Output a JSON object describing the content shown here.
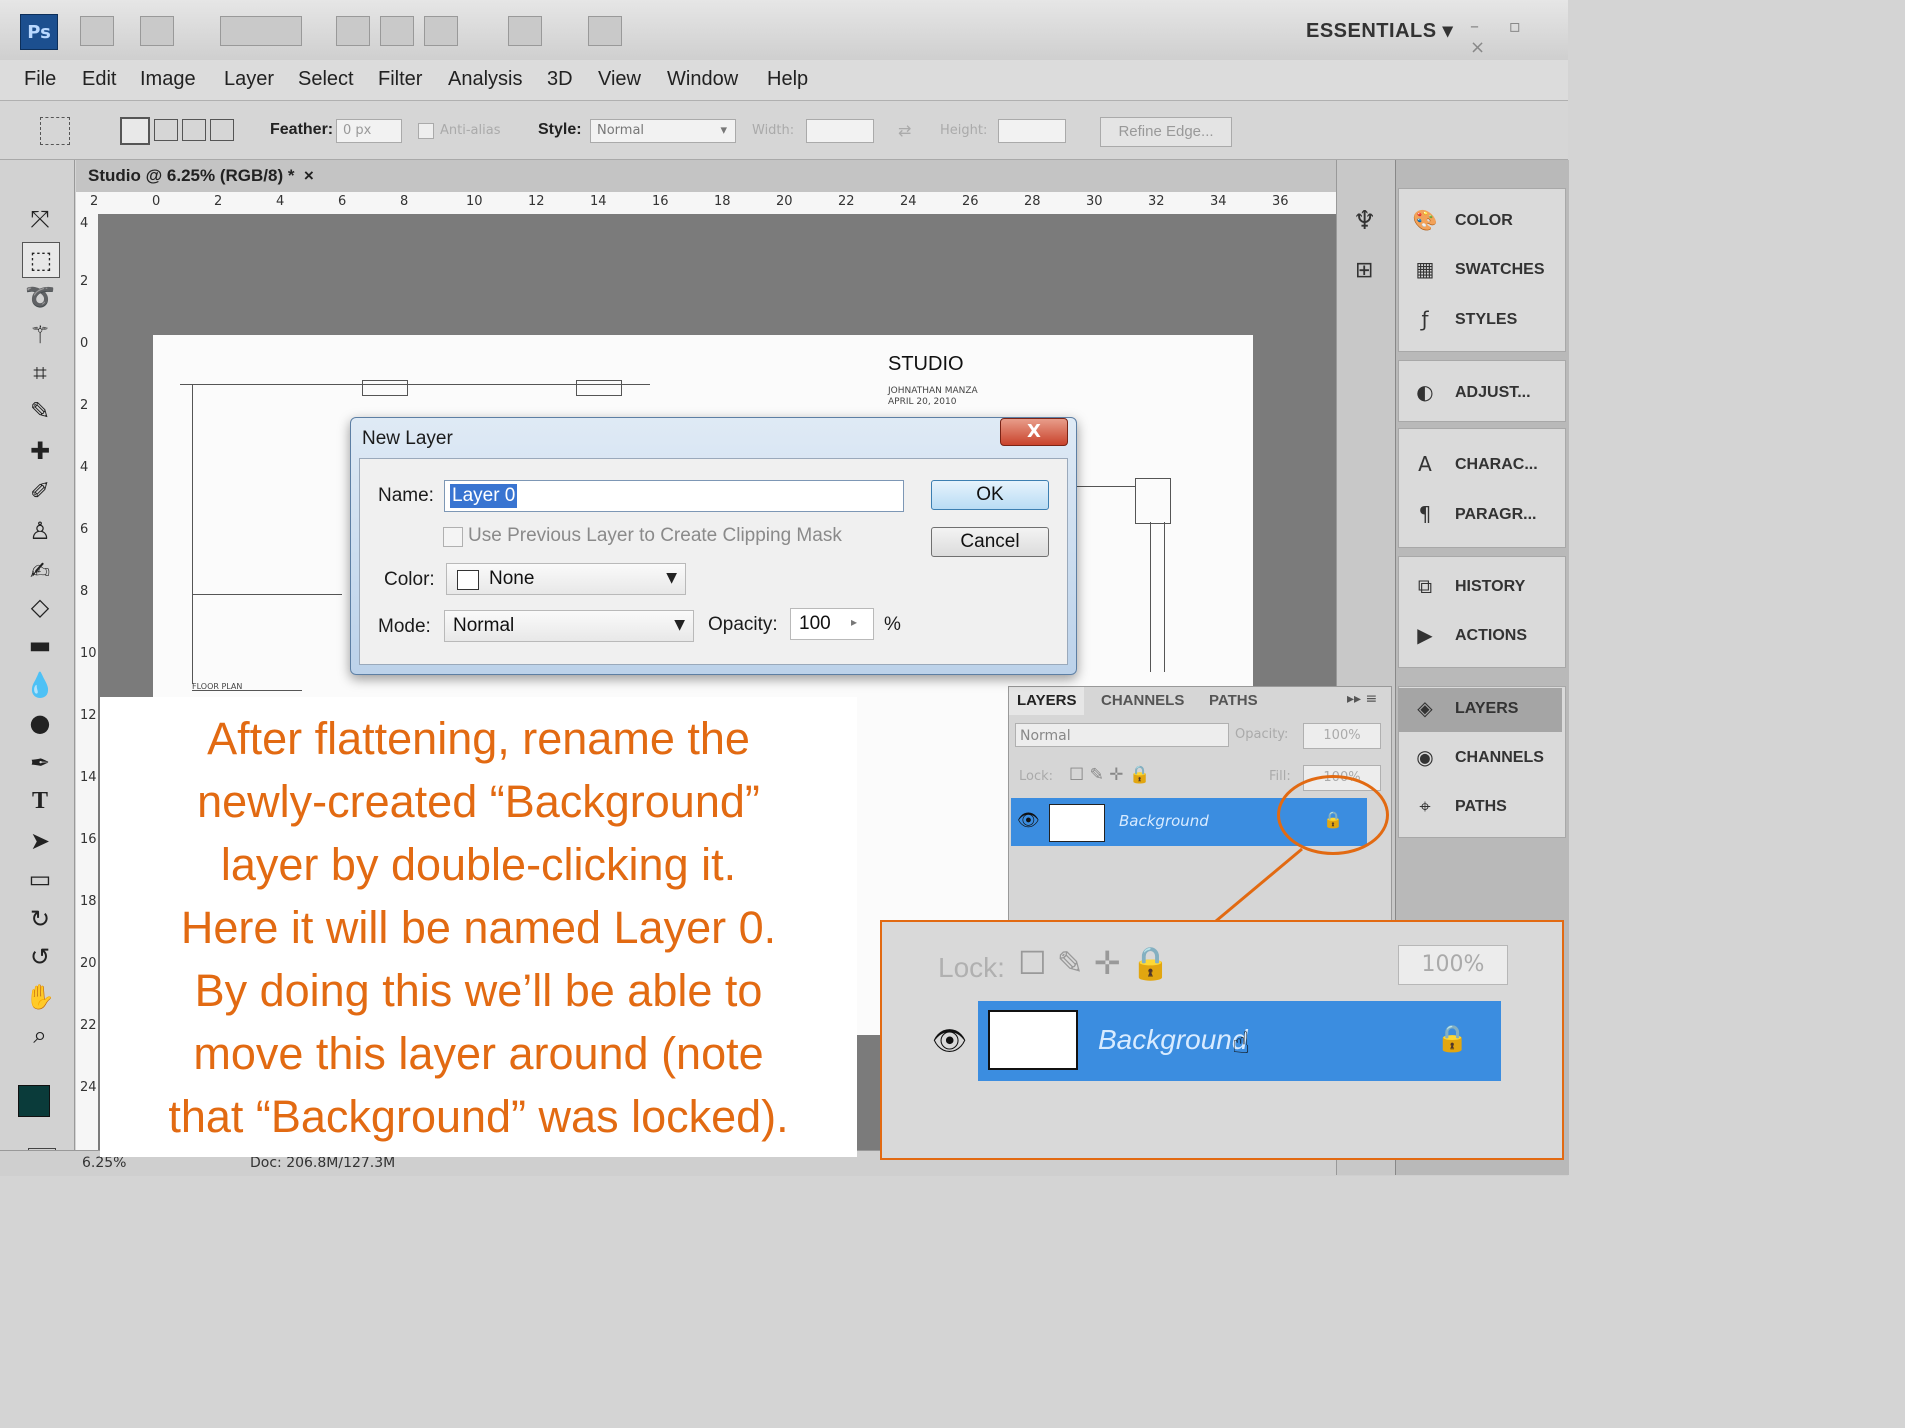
{
  "app": {
    "logo": "Ps",
    "workspace": "ESSENTIALS"
  },
  "menu": [
    "File",
    "Edit",
    "Image",
    "Layer",
    "Select",
    "Filter",
    "Analysis",
    "3D",
    "View",
    "Window",
    "Help"
  ],
  "options_bar": {
    "feather_label": "Feather:",
    "feather_value": "0 px",
    "antialias_label": "Anti-alias",
    "style_label": "Style:",
    "style_value": "Normal",
    "width_label": "Width:",
    "height_label": "Height:",
    "refine_edge": "Refine Edge..."
  },
  "document": {
    "tab_title": "Studio @ 6.25% (RGB/8) *",
    "close": "×",
    "ruler_top": [
      "2",
      "0",
      "2",
      "4",
      "6",
      "8",
      "10",
      "12",
      "14",
      "16",
      "18",
      "20",
      "22",
      "24",
      "26",
      "28",
      "30",
      "32",
      "34",
      "36"
    ],
    "ruler_left": [
      "4",
      "2",
      "0",
      "2",
      "4",
      "6",
      "8",
      "10",
      "12",
      "14",
      "16",
      "18",
      "20",
      "22",
      "24"
    ],
    "studio_title": "STUDIO",
    "studio_author": "JOHNATHAN MANZA",
    "studio_date": "APRIL 20, 2010",
    "plan_label": "FLOOR PLAN"
  },
  "status_bar": {
    "zoom": "6.25%",
    "doc": "Doc: 206.8M/127.3M"
  },
  "right_panels": [
    {
      "icon": "color-icon",
      "label": "COLOR"
    },
    {
      "icon": "swatches-icon",
      "label": "SWATCHES"
    },
    {
      "icon": "styles-icon",
      "label": "STYLES"
    },
    {
      "icon": "adjustments-icon",
      "label": "ADJUST..."
    },
    {
      "icon": "character-icon",
      "label": "CHARAC..."
    },
    {
      "icon": "paragraph-icon",
      "label": "PARAGR..."
    },
    {
      "icon": "history-icon",
      "label": "HISTORY"
    },
    {
      "icon": "actions-icon",
      "label": "ACTIONS"
    },
    {
      "icon": "layers-icon",
      "label": "LAYERS"
    },
    {
      "icon": "channels-icon",
      "label": "CHANNELS"
    },
    {
      "icon": "paths-icon",
      "label": "PATHS"
    }
  ],
  "layers_panel": {
    "tabs": [
      "LAYERS",
      "CHANNELS",
      "PATHS"
    ],
    "blend_mode": "Normal",
    "opacity_label": "Opacity:",
    "opacity_value": "100%",
    "lock_label": "Lock:",
    "fill_label": "Fill:",
    "fill_value": "100%",
    "layer_name": "Background"
  },
  "dialog": {
    "title": "New Layer",
    "close": "X",
    "name_label": "Name:",
    "name_value": "Layer 0",
    "clip_label": "Use Previous Layer to Create Clipping Mask",
    "color_label": "Color:",
    "color_value": "None",
    "mode_label": "Mode:",
    "mode_value": "Normal",
    "opacity_label": "Opacity:",
    "opacity_value": "100",
    "percent": "%",
    "ok": "OK",
    "cancel": "Cancel"
  },
  "caption": {
    "lines": [
      "After flattening, rename the",
      "newly-created “Background”",
      "layer by double-clicking it.",
      "Here it will be named Layer 0.",
      "By doing this we’ll be able to",
      "move this layer around (note",
      "that “Background” was locked)."
    ]
  },
  "zoom_inset": {
    "lock_label": "Lock:",
    "fill_value": "100%",
    "layer_name": "Background"
  },
  "colors": {
    "accent": "#e26a12",
    "selection_blue": "#3b8de0",
    "foreground": "#0a3b3a"
  }
}
